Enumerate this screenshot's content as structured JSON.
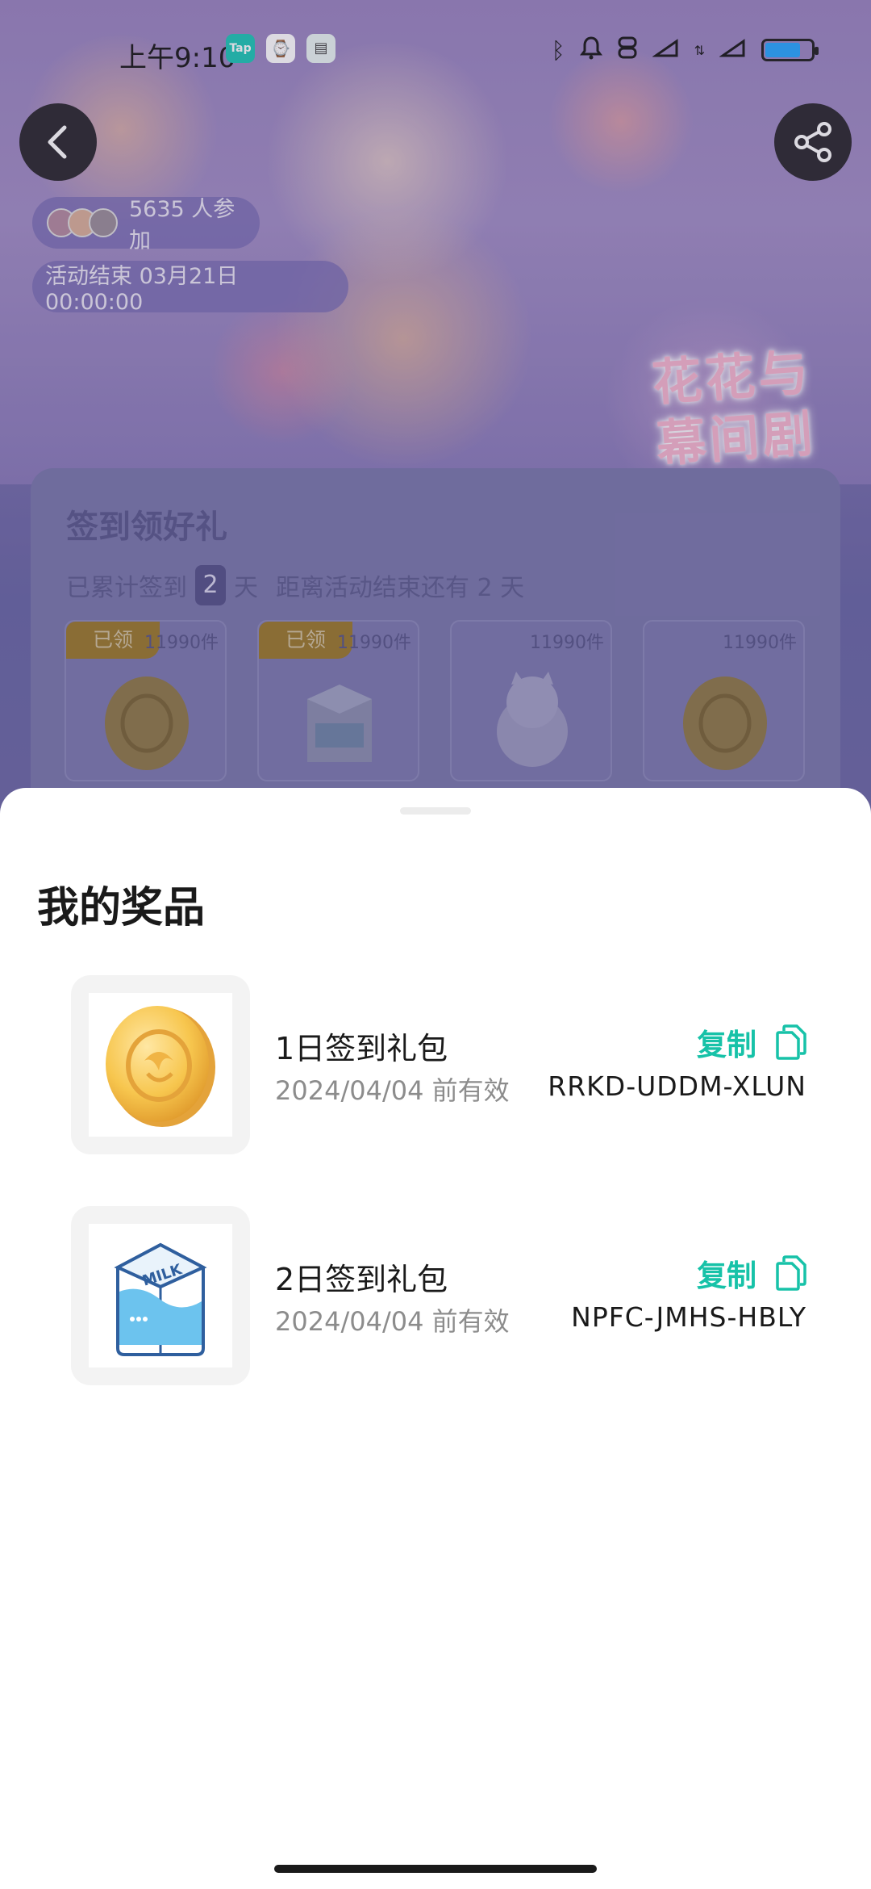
{
  "status_bar": {
    "time": "上午9:10",
    "app_icons": [
      "tap-app-icon",
      "watch-app-icon",
      "document-app-icon"
    ],
    "app_icon_labels": {
      "tap": "Tap"
    },
    "battery_level": 0.77
  },
  "header": {
    "back": "back-icon",
    "share": "share-icon"
  },
  "banner": {
    "art_title": "花花与幕间剧",
    "participants_text": "5635 人参加",
    "end_text": "活动结束 03月21日 00:00:00"
  },
  "signin_card": {
    "title": "签到领好礼",
    "sub_prefix": "已累计签到",
    "days": "2",
    "sub_suffix": "天",
    "remaining": "距离活动结束还有 2 天",
    "gifts": [
      {
        "tag": "已领",
        "count": "11990件",
        "icon": "coin-icon"
      },
      {
        "tag": "已领",
        "count": "11990件",
        "icon": "milk-carton-icon"
      },
      {
        "tag": "",
        "count": "11990件",
        "icon": "cat-plush-icon"
      },
      {
        "tag": "",
        "count": "11990件",
        "icon": "coin-icon"
      }
    ]
  },
  "sheet": {
    "title": "我的奖品",
    "prizes": [
      {
        "name": "1日签到礼包",
        "valid": "2024/04/04 前有效",
        "copy_label": "复制",
        "code": "RRKD-UDDM-XLUN",
        "icon": "coin-icon"
      },
      {
        "name": "2日签到礼包",
        "valid": "2024/04/04 前有效",
        "copy_label": "复制",
        "code": "NPFC-JMHS-HBLY",
        "icon": "milk-carton-icon"
      }
    ]
  },
  "colors": {
    "accent": "#17c2a8",
    "sheet_bg": "#ffffff",
    "banner_bg": "#7f73b0"
  }
}
